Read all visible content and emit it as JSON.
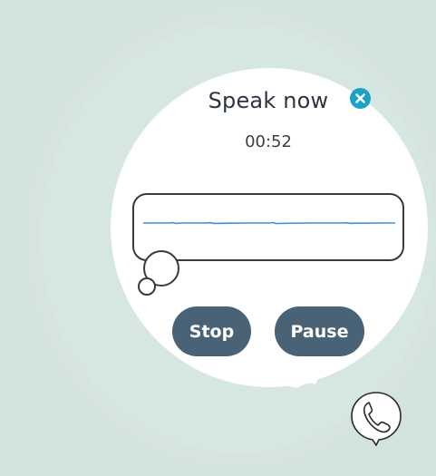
{
  "dialog": {
    "title": "Speak now",
    "timer": "00:52",
    "close_icon": "close-icon",
    "stop_label": "Stop",
    "pause_label": "Pause"
  },
  "colors": {
    "background": "#d3e3df",
    "bubble": "#ffffff",
    "accent": "#1aa3c7",
    "button": "#4a6275",
    "waveform": "#3d8fd6"
  },
  "icons": {
    "close": "close-icon",
    "phone": "phone-icon"
  }
}
